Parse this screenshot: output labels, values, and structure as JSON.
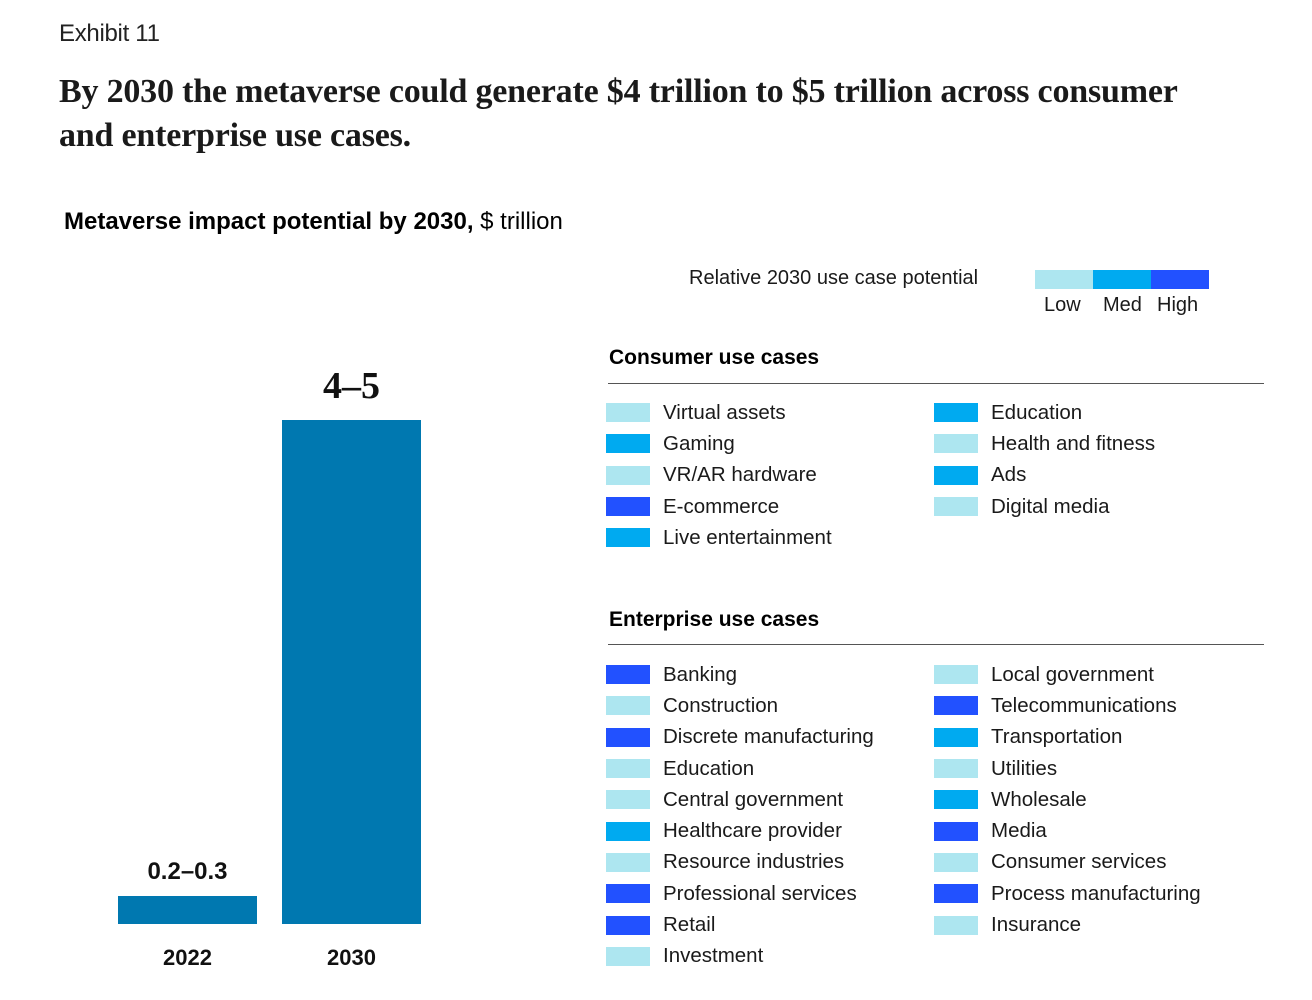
{
  "exhibit_label": "Exhibit 11",
  "headline": "By 2030 the metaverse could generate $4 trillion to $5 trillion across consumer and enterprise use cases.",
  "subtitle": {
    "bold": "Metaverse impact potential by 2030,",
    "unit": " $ trillion"
  },
  "potential_scale": {
    "label": "Relative 2030 use case potential",
    "levels": [
      {
        "name": "Low",
        "color": "#ADE6F0"
      },
      {
        "name": "Med",
        "color": "#00AAF0"
      },
      {
        "name": "High",
        "color": "#2251FF"
      }
    ]
  },
  "consumer": {
    "title": "Consumer use cases",
    "columns": [
      [
        {
          "label": "Virtual assets",
          "level": "Low"
        },
        {
          "label": "Gaming",
          "level": "Med"
        },
        {
          "label": "VR/AR hardware",
          "level": "Low"
        },
        {
          "label": "E-commerce",
          "level": "High"
        },
        {
          "label": "Live entertainment",
          "level": "Med"
        }
      ],
      [
        {
          "label": "Education",
          "level": "Med"
        },
        {
          "label": "Health and fitness",
          "level": "Low"
        },
        {
          "label": "Ads",
          "level": "Med"
        },
        {
          "label": "Digital media",
          "level": "Low"
        }
      ]
    ]
  },
  "enterprise": {
    "title": "Enterprise use cases",
    "columns": [
      [
        {
          "label": "Banking",
          "level": "High"
        },
        {
          "label": "Construction",
          "level": "Low"
        },
        {
          "label": "Discrete manufacturing",
          "level": "High"
        },
        {
          "label": "Education",
          "level": "Low"
        },
        {
          "label": "Central government",
          "level": "Low"
        },
        {
          "label": "Healthcare provider",
          "level": "Med"
        },
        {
          "label": "Resource industries",
          "level": "Low"
        },
        {
          "label": "Professional services",
          "level": "High"
        },
        {
          "label": "Retail",
          "level": "High"
        },
        {
          "label": "Investment",
          "level": "Low"
        }
      ],
      [
        {
          "label": "Local government",
          "level": "Low"
        },
        {
          "label": "Telecommunications",
          "level": "High"
        },
        {
          "label": "Transportation",
          "level": "Med"
        },
        {
          "label": "Utilities",
          "level": "Low"
        },
        {
          "label": "Wholesale",
          "level": "Med"
        },
        {
          "label": "Media",
          "level": "High"
        },
        {
          "label": "Consumer services",
          "level": "Low"
        },
        {
          "label": "Process manufacturing",
          "level": "High"
        },
        {
          "label": "Insurance",
          "level": "Low"
        }
      ]
    ]
  },
  "chart_data": {
    "type": "bar",
    "title": "Metaverse impact potential by 2030, $ trillion",
    "xlabel": "",
    "ylabel": "$ trillion",
    "categories": [
      "2022",
      "2030"
    ],
    "values": [
      0.25,
      4.5
    ],
    "value_ranges": [
      [
        0.2,
        0.3
      ],
      [
        4,
        5
      ]
    ],
    "data_labels": [
      "0.2–0.3",
      "4–5"
    ],
    "bar_color": "#0078B0",
    "ylim": [
      0,
      4.5
    ],
    "grid": false,
    "legend": "none"
  }
}
